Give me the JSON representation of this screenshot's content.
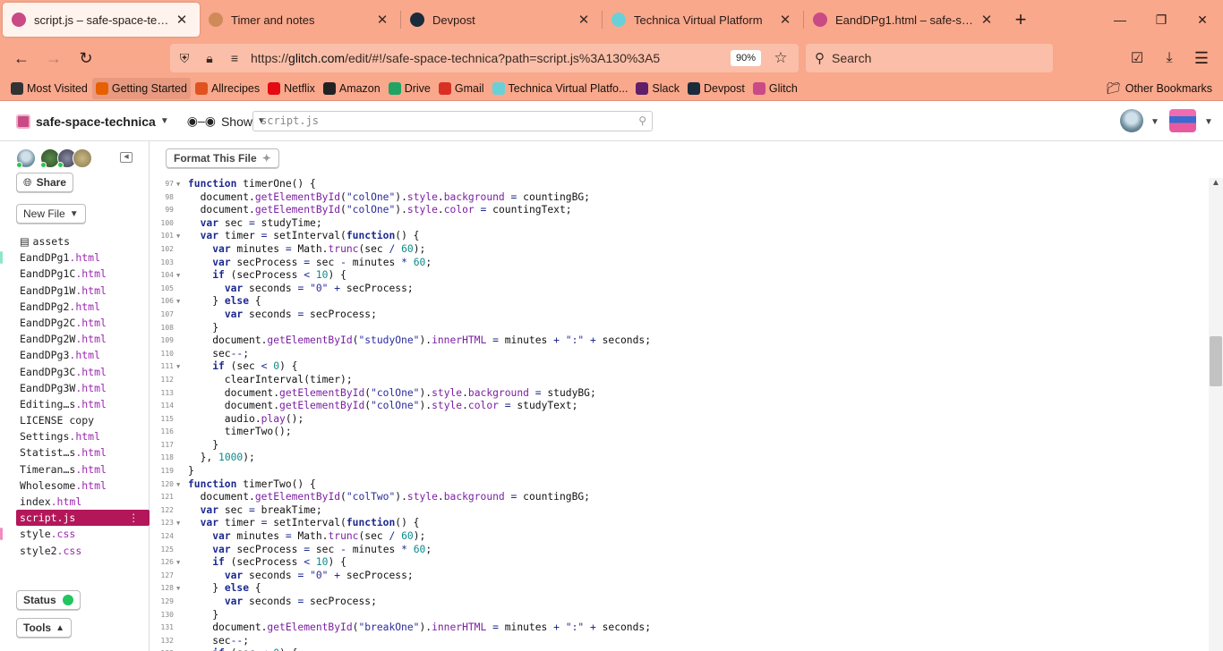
{
  "browser": {
    "tabs": [
      {
        "title": "script.js – safe-space-technica",
        "favicon_color": "#c94a85",
        "active": true
      },
      {
        "title": "Timer and notes",
        "favicon_color": "#d08a5a",
        "active": false
      },
      {
        "title": "Devpost",
        "favicon_color": "#1a2b3c",
        "active": false
      },
      {
        "title": "Technica Virtual Platform",
        "favicon_color": "#6ad0d8",
        "active": false
      },
      {
        "title": "EandDPg1.html – safe-space-technica",
        "favicon_color": "#c94a85",
        "active": false
      }
    ],
    "new_tab_label": "+",
    "url_prefix": "https://",
    "url_host": "glitch.com",
    "url_rest": "/edit/#!/safe-space-technica?path=script.js%3A130%3A5",
    "zoom": "90%",
    "search_placeholder": "Search",
    "bookmarks": [
      {
        "label": "Most Visited",
        "icon": "gear-icon",
        "color": "#333333"
      },
      {
        "label": "Getting Started",
        "icon": "firefox-icon",
        "color": "#e66000"
      },
      {
        "label": "Allrecipes",
        "icon": "allrecipes-icon",
        "color": "#e0531f"
      },
      {
        "label": "Netflix",
        "icon": "netflix-icon",
        "color": "#e50914"
      },
      {
        "label": "Amazon",
        "icon": "amazon-icon",
        "color": "#222222"
      },
      {
        "label": "Drive",
        "icon": "drive-icon",
        "color": "#1fa463"
      },
      {
        "label": "Gmail",
        "icon": "gmail-icon",
        "color": "#d93025"
      },
      {
        "label": "Technica Virtual Platfo...",
        "icon": "technica-icon",
        "color": "#6ad0d8"
      },
      {
        "label": "Slack",
        "icon": "slack-icon",
        "color": "#611f69"
      },
      {
        "label": "Devpost",
        "icon": "devpost-icon",
        "color": "#1a2b3c"
      },
      {
        "label": "Glitch",
        "icon": "glitch-icon",
        "color": "#c94a85"
      }
    ],
    "other_bookmarks": "Other Bookmarks"
  },
  "glitch": {
    "project_name": "safe-space-technica",
    "show_label": "Show",
    "file_search_value": "script.js",
    "share_label": "Share",
    "new_file_label": "New File",
    "format_label": "Format This File",
    "status_label": "Status",
    "tools_label": "Tools",
    "files": [
      {
        "name": "assets",
        "ext": "",
        "folder": true,
        "mark": ""
      },
      {
        "name": "EandDPg1",
        "ext": ".html",
        "mark": "#8ee6c8"
      },
      {
        "name": "EandDPg1C",
        "ext": ".html",
        "mark": ""
      },
      {
        "name": "EandDPg1W",
        "ext": ".html",
        "mark": ""
      },
      {
        "name": "EandDPg2",
        "ext": ".html",
        "mark": ""
      },
      {
        "name": "EandDPg2C",
        "ext": ".html",
        "mark": ""
      },
      {
        "name": "EandDPg2W",
        "ext": ".html",
        "mark": ""
      },
      {
        "name": "EandDPg3",
        "ext": ".html",
        "mark": ""
      },
      {
        "name": "EandDPg3C",
        "ext": ".html",
        "mark": ""
      },
      {
        "name": "EandDPg3W",
        "ext": ".html",
        "mark": ""
      },
      {
        "name": "Editing…s",
        "ext": ".html",
        "mark": ""
      },
      {
        "name": "LICENSE copy",
        "ext": "",
        "mark": ""
      },
      {
        "name": "Settings",
        "ext": ".html",
        "mark": ""
      },
      {
        "name": "Statist…s",
        "ext": ".html",
        "mark": ""
      },
      {
        "name": "Timeran…s",
        "ext": ".html",
        "mark": ""
      },
      {
        "name": "Wholesome",
        "ext": ".html",
        "mark": ""
      },
      {
        "name": "index",
        "ext": ".html",
        "mark": ""
      },
      {
        "name": "script",
        "ext": ".js",
        "active": true,
        "mark": ""
      },
      {
        "name": "style",
        "ext": ".css",
        "mark": "#f28ac0"
      },
      {
        "name": "style2",
        "ext": ".css",
        "mark": ""
      }
    ]
  },
  "code": [
    {
      "n": "97",
      "fold": true,
      "t": "function timerOne() {"
    },
    {
      "n": "98",
      "t": "  document.getElementById(\"colOne\").style.background = countingBG;"
    },
    {
      "n": "99",
      "t": "  document.getElementById(\"colOne\").style.color = countingText;"
    },
    {
      "n": "100",
      "t": "  var sec = studyTime;"
    },
    {
      "n": "101",
      "fold": true,
      "t": "  var timer = setInterval(function() {"
    },
    {
      "n": "102",
      "t": "    var minutes = Math.trunc(sec / 60);"
    },
    {
      "n": "103",
      "t": "    var secProcess = sec - minutes * 60;"
    },
    {
      "n": "104",
      "fold": true,
      "t": "    if (secProcess < 10) {"
    },
    {
      "n": "105",
      "t": "      var seconds = \"0\" + secProcess;"
    },
    {
      "n": "106",
      "fold": true,
      "t": "    } else {"
    },
    {
      "n": "107",
      "t": "      var seconds = secProcess;"
    },
    {
      "n": "108",
      "t": "    }"
    },
    {
      "n": "109",
      "t": "    document.getElementById(\"studyOne\").innerHTML = minutes + \":\" + seconds;"
    },
    {
      "n": "110",
      "t": "    sec--;"
    },
    {
      "n": "111",
      "fold": true,
      "t": "    if (sec < 0) {"
    },
    {
      "n": "112",
      "t": "      clearInterval(timer);"
    },
    {
      "n": "113",
      "t": "      document.getElementById(\"colOne\").style.background = studyBG;"
    },
    {
      "n": "114",
      "t": "      document.getElementById(\"colOne\").style.color = studyText;"
    },
    {
      "n": "115",
      "t": "      audio.play();"
    },
    {
      "n": "116",
      "t": "      timerTwo();"
    },
    {
      "n": "117",
      "t": "    }"
    },
    {
      "n": "118",
      "t": "  }, 1000);"
    },
    {
      "n": "119",
      "t": "}"
    },
    {
      "n": "120",
      "fold": true,
      "t": "function timerTwo() {"
    },
    {
      "n": "121",
      "t": "  document.getElementById(\"colTwo\").style.background = countingBG;"
    },
    {
      "n": "122",
      "t": "  var sec = breakTime;"
    },
    {
      "n": "123",
      "fold": true,
      "t": "  var timer = setInterval(function() {"
    },
    {
      "n": "124",
      "t": "    var minutes = Math.trunc(sec / 60);"
    },
    {
      "n": "125",
      "t": "    var secProcess = sec - minutes * 60;"
    },
    {
      "n": "126",
      "fold": true,
      "t": "    if (secProcess < 10) {"
    },
    {
      "n": "127",
      "t": "      var seconds = \"0\" + secProcess;"
    },
    {
      "n": "128",
      "fold": true,
      "t": "    } else {"
    },
    {
      "n": "129",
      "t": "      var seconds = secProcess;"
    },
    {
      "n": "130",
      "t": "    }"
    },
    {
      "n": "131",
      "t": "    document.getElementById(\"breakOne\").innerHTML = minutes + \":\" + seconds;"
    },
    {
      "n": "132",
      "t": "    sec--;"
    },
    {
      "n": "133",
      "fold": true,
      "t": "    if (sec < 0) {"
    }
  ]
}
